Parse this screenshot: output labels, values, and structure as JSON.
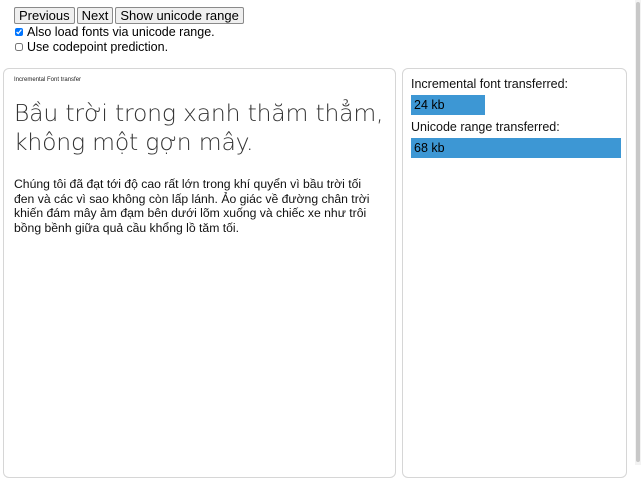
{
  "toolbar": {
    "previous_label": "Previous",
    "next_label": "Next",
    "show_unicode_label": "Show unicode range"
  },
  "options": {
    "load_unicode_range": {
      "label": "Also load fonts via unicode range.",
      "checked": true
    },
    "codepoint_prediction": {
      "label": "Use codepoint prediction.",
      "checked": false
    }
  },
  "sample": {
    "title": "Incremental Font transfer",
    "heading": "Bầu trời trong xanh thăm thẳm, không một gợn mây.",
    "paragraph": "Chúng tôi đã đạt tới độ cao rất lớn trong khí quyển vì bầu trời tối đen và các vì sao không còn lấp lánh. Ảo giác về đường chân trời khiến đám mây ảm đạm bên dưới lõm xuống và chiếc xe như trôi bồng bềnh giữa quả cầu khổng lồ tăm tối."
  },
  "stats": {
    "incremental": {
      "label": "Incremental font transferred:",
      "value_text": "24 kb",
      "kb": 24
    },
    "unicode_range": {
      "label": "Unicode range transferred:",
      "value_text": "68 kb",
      "kb": 68
    },
    "bar_color": "#3d97d4"
  }
}
